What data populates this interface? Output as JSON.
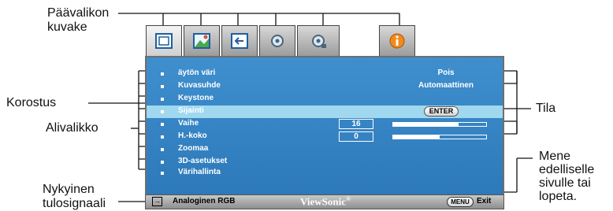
{
  "labels": {
    "main_menu_icon": [
      "Päävalikon",
      "kuvake"
    ],
    "highlight": "Korostus",
    "submenu": "Alivalikko",
    "current_input": [
      "Nykyinen",
      "tulosignaali"
    ],
    "status": "Tila",
    "go_back": [
      "Mene",
      "edelliselle",
      "sivulle tai",
      "lopeta."
    ]
  },
  "tabs": [
    {
      "icon": "display-icon",
      "active": true
    },
    {
      "icon": "picture-icon",
      "active": false
    },
    {
      "icon": "source-icon",
      "active": false
    },
    {
      "icon": "system-setup-icon",
      "active": false
    },
    {
      "icon": "advanced-setup-icon",
      "active": false
    },
    {
      "icon": "information-icon",
      "active": false
    }
  ],
  "menu_items": [
    {
      "name": "äytön väri",
      "value": "Pois"
    },
    {
      "name": "Kuvasuhde",
      "value": "Automaattinen"
    },
    {
      "name": "Keystone"
    },
    {
      "name": "Sijainti",
      "button": "ENTER",
      "highlighted": true
    },
    {
      "name": "Vaihe",
      "number": "16",
      "level": 0.7
    },
    {
      "name": "H.-koko",
      "number": "0",
      "level": 0.5
    },
    {
      "name": "Zoomaa"
    },
    {
      "name": "3D-asetukset"
    },
    {
      "name": "Värihallinta"
    }
  ],
  "footer": {
    "input_icon": "input-signal-icon",
    "signal": "Analoginen RGB",
    "brand": "ViewSonic",
    "brand_mark": "®",
    "menu_button": "MENU",
    "exit": "Exit"
  },
  "colors": {
    "osd_background": "#3588c6",
    "highlight_row": "#9fd8ef",
    "callout_lines": "#111111"
  }
}
